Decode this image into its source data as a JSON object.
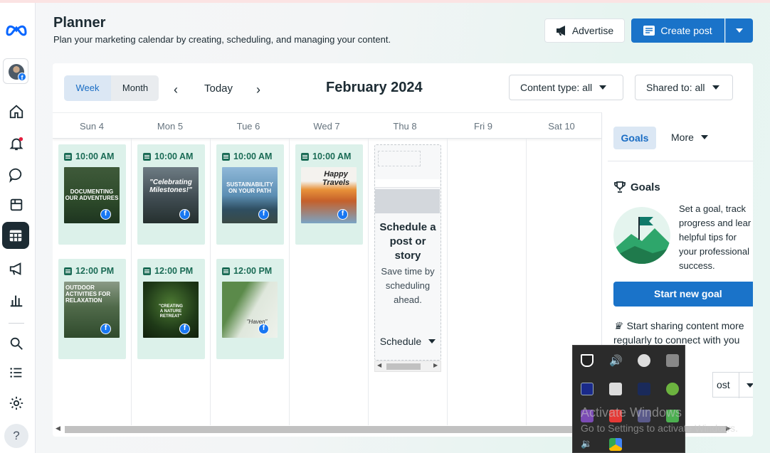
{
  "colors": {
    "accent": "#1a73c9",
    "post_bg": "#dcf1ea",
    "post_time": "#1a6b55",
    "rail_selected": "#1c2b33"
  },
  "header": {
    "title": "Planner",
    "subtitle": "Plan your marketing calendar by creating, scheduling, and managing your content.",
    "advertise_label": "Advertise",
    "create_post_label": "Create post"
  },
  "rail": {
    "icons": [
      "meta-logo-icon",
      "avatar",
      "home-icon",
      "notifications-icon",
      "messages-icon",
      "content-icon",
      "planner-icon",
      "ads-icon",
      "insights-icon",
      "search-icon",
      "all-tools-icon",
      "settings-icon",
      "help-icon"
    ],
    "help_glyph": "?"
  },
  "toolbar": {
    "week_label": "Week",
    "month_label": "Month",
    "today_label": "Today",
    "current_period": "February 2024",
    "content_type_filter": "Content type: all",
    "shared_to_filter": "Shared to: all"
  },
  "days": [
    "Sun 4",
    "Mon 5",
    "Tue 6",
    "Wed 7",
    "Thu 8",
    "Fri 9",
    "Sat 10"
  ],
  "posts": [
    {
      "time": "10:00 AM",
      "caption": "DOCUMENTING OUR ADVENTURES"
    },
    {
      "time": "10:00 AM",
      "caption": "\"Celebrating Milestones!\""
    },
    {
      "time": "10:00 AM",
      "caption": "SUSTAINABILITY ON YOUR PATH"
    },
    {
      "time": "10:00 AM",
      "caption": "Happy Travels"
    },
    {
      "time": "12:00 PM",
      "caption": "OUTDOOR ACTIVITIES FOR RELAXATION"
    },
    {
      "time": "12:00 PM",
      "caption": "\"CREATING A NATURE RETREAT\""
    },
    {
      "time": "12:00 PM",
      "caption": "\"Haven\""
    }
  ],
  "schedule_slot": {
    "title": "Schedule a post or story",
    "description": "Save time by scheduling ahead.",
    "button_label": "Schedule"
  },
  "right_panel": {
    "tab_goals": "Goals",
    "tab_more": "More",
    "goals_heading": "Goals",
    "goals_text_lines": [
      "Set a goal, track",
      "progress and lear",
      "helpful tips for",
      "your professional",
      "success."
    ],
    "start_goal_label": "Start new goal",
    "share_text_lines": [
      "Start sharing content more",
      "regularly to connect with you"
    ],
    "partial_button_label": "ost"
  },
  "system": {
    "watermark_title": "Activate Windows",
    "watermark_sub": "Go to Settings to activate Windows."
  }
}
